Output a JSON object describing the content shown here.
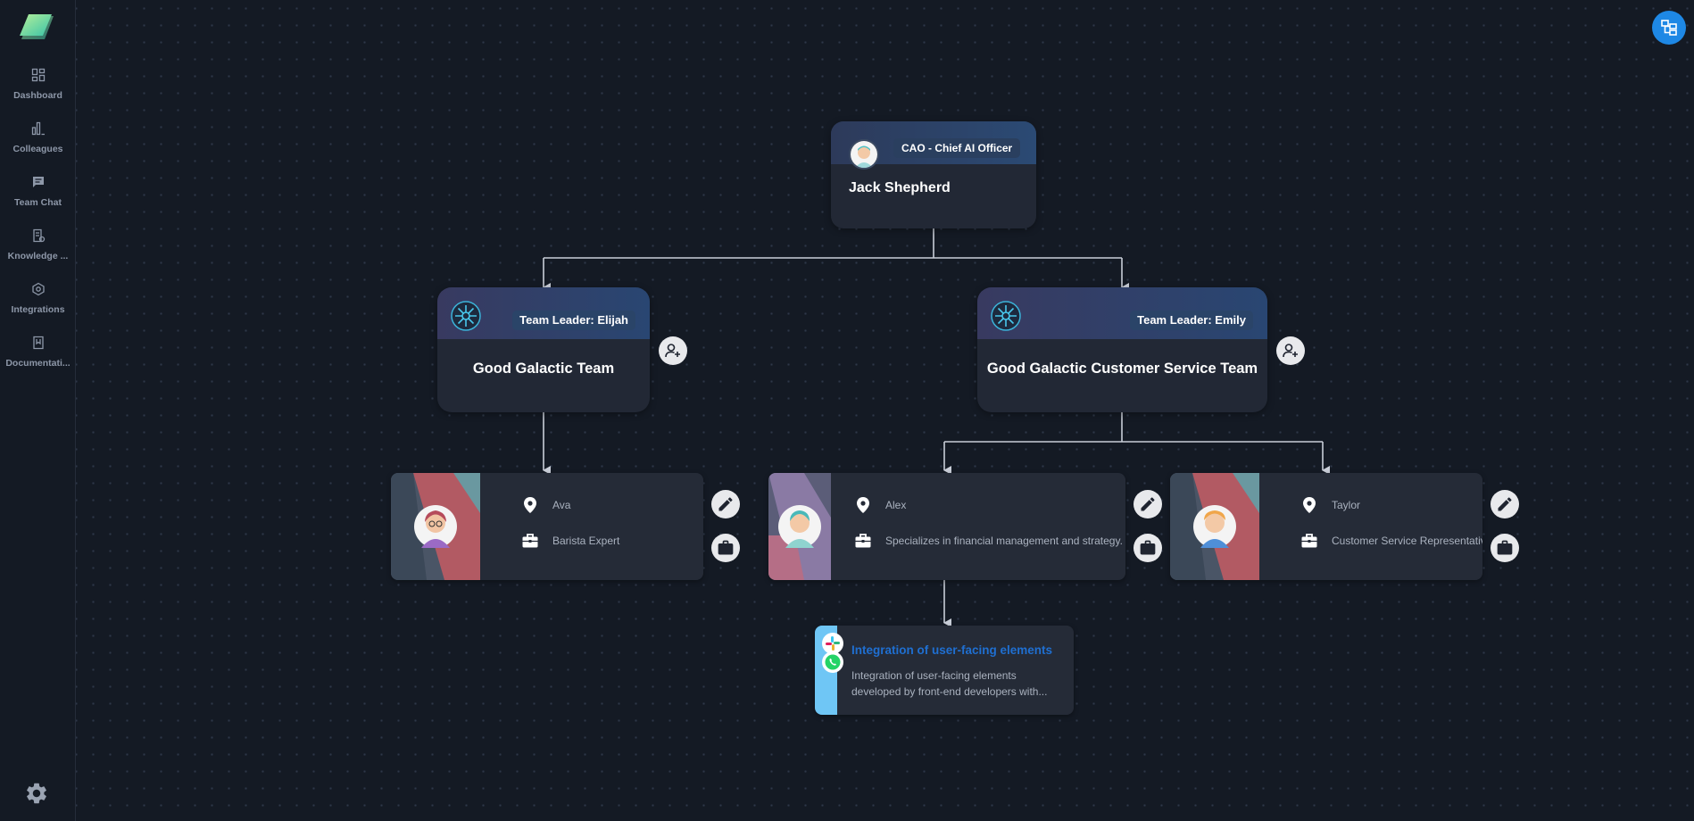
{
  "sidebar": {
    "items": [
      {
        "label": "Dashboard",
        "icon": "dashboard-icon"
      },
      {
        "label": "Colleagues",
        "icon": "bar-chart-icon"
      },
      {
        "label": "Team Chat",
        "icon": "chat-icon"
      },
      {
        "label": "Knowledge ...",
        "icon": "knowledge-icon"
      },
      {
        "label": "Integrations",
        "icon": "integrations-icon"
      },
      {
        "label": "Documentati...",
        "icon": "documentation-icon"
      }
    ],
    "settings_icon": "gear-icon"
  },
  "toolbar": {
    "layout_toggle_icon": "org-chart-icon"
  },
  "org": {
    "root": {
      "badge": "CAO - Chief AI Officer",
      "name": "Jack Shepherd"
    },
    "teams": [
      {
        "leader": "Team Leader: Elijah",
        "name": "Good Galactic Team"
      },
      {
        "leader": "Team Leader: Emily",
        "name": "Good Galactic Customer Service Team"
      }
    ],
    "members": [
      {
        "name": "Ava",
        "role": "Barista Expert"
      },
      {
        "name": "Alex",
        "role": "Specializes in financial management and strategy."
      },
      {
        "name": "Taylor",
        "role": "Customer Service Representative"
      }
    ],
    "integration": {
      "title": "Integration of user-facing elements",
      "description": "Integration of user-facing elements developed by front-end developers with...",
      "apps": [
        "slack-icon",
        "whatsapp-icon"
      ]
    }
  },
  "colors": {
    "background": "#141a24",
    "card": "#222835",
    "accent": "#1e88e5",
    "link": "#1f6fd1",
    "stripe": "#6fc6f5"
  }
}
